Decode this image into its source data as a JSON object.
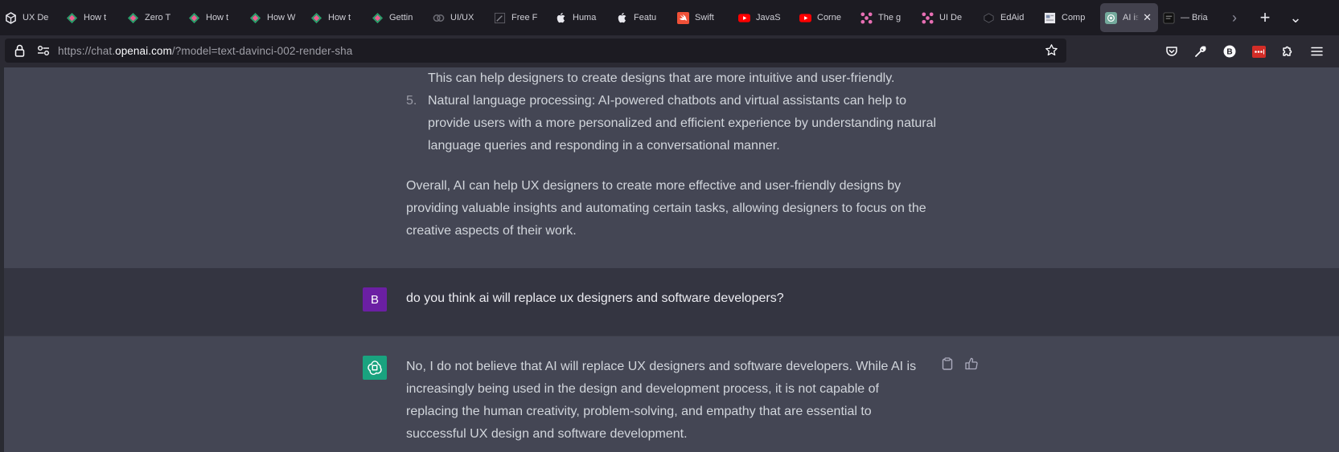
{
  "tabs": [
    {
      "label": "UX De",
      "icon": "hexagon-logo-icon"
    },
    {
      "label": "How t",
      "icon": "green-gem-icon"
    },
    {
      "label": "Zero T",
      "icon": "green-gem-icon"
    },
    {
      "label": "How t",
      "icon": "green-gem-icon"
    },
    {
      "label": "How W",
      "icon": "green-gem-icon"
    },
    {
      "label": "How t",
      "icon": "green-gem-icon"
    },
    {
      "label": "Gettin",
      "icon": "green-gem-icon"
    },
    {
      "label": "UI/UX",
      "icon": "cc-logo-icon"
    },
    {
      "label": "Free F",
      "icon": "pen-icon"
    },
    {
      "label": "Huma",
      "icon": "apple-logo-icon"
    },
    {
      "label": "Featu",
      "icon": "apple-logo-icon"
    },
    {
      "label": "Swift",
      "icon": "swift-logo-icon"
    },
    {
      "label": "JavaS",
      "icon": "youtube-icon"
    },
    {
      "label": "Corne",
      "icon": "youtube-icon"
    },
    {
      "label": "The g",
      "icon": "pink-dots-icon"
    },
    {
      "label": "UI De",
      "icon": "pink-dots-icon"
    },
    {
      "label": "EdAid",
      "icon": "edaid-logo-icon"
    },
    {
      "label": "Comp",
      "icon": "doc-icon"
    },
    {
      "label": "AI is",
      "icon": "openai-logo-icon",
      "active": true
    },
    {
      "label": "— Bria",
      "icon": "dark-square-icon"
    }
  ],
  "tab_controls": {
    "scroll": "›",
    "new_tab": "+",
    "list_all": "⌄"
  },
  "address": {
    "prefix": "https://chat.",
    "host": "openai.com",
    "rest": "/?model=text-davinci-002-render-sha"
  },
  "conversation": {
    "assistant_top": {
      "continuation": "This can help designers to create designs that are more intuitive and user-friendly.",
      "item_number": "5.",
      "item_text": "Natural language processing: AI-powered chatbots and virtual assistants can help to provide users with a more personalized and efficient experience by understanding natural language queries and responding in a conversational manner.",
      "summary": "Overall, AI can help UX designers to create more effective and user-friendly designs by providing valuable insights and automating certain tasks, allowing designers to focus on the creative aspects of their work."
    },
    "user": {
      "avatar_letter": "B",
      "message": "do you think ai will replace ux designers and software developers?"
    },
    "assistant_bottom": {
      "answer": "No, I do not believe that AI will replace UX designers and software developers. While AI is increasingly being used in the design and development process, it is not capable of replacing the human creativity, problem-solving, and empathy that are essential to successful UX design and software development."
    }
  },
  "colors": {
    "user_avatar": "#6b1fa3",
    "assistant_avatar": "#19a37f",
    "assistant_bg": "#444654",
    "user_bg": "#343541"
  }
}
